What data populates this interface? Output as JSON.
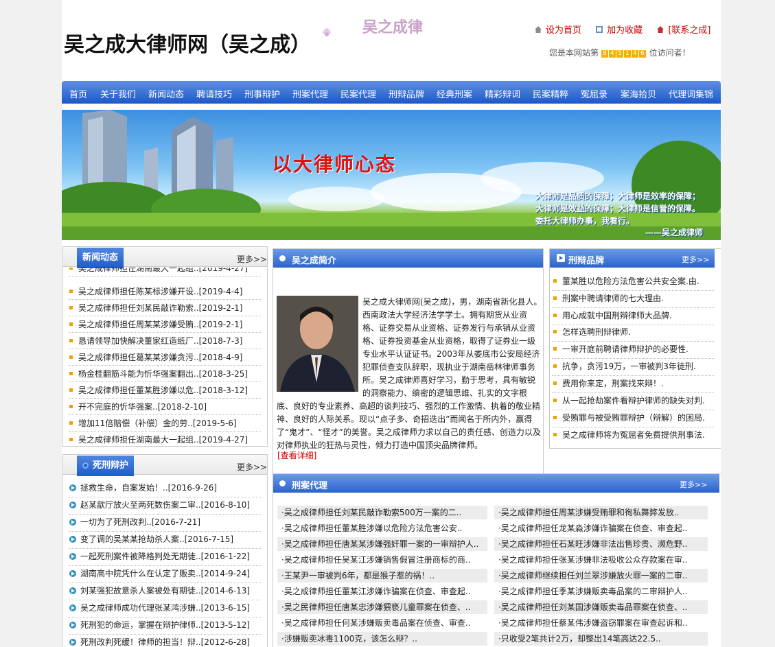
{
  "header": {
    "site_title": "吴之成大律师网（吴之成）",
    "logo_text": "吴之成律",
    "links": {
      "home": "设为首页",
      "favorite": "加为收藏",
      "contact": "[联系之成]"
    },
    "visitor_prefix": "您是本网站第",
    "visitor_digits": [
      "8",
      "4",
      "5",
      "1",
      "4",
      "6"
    ],
    "visitor_suffix": "位访问者！"
  },
  "nav": [
    "首页",
    "关于我们",
    "新闻动态",
    "聘请技巧",
    "刑事辩护",
    "刑案代理",
    "民案代理",
    "刑辩品牌",
    "经典刑案",
    "精彩辩词",
    "民案精粹",
    "冤屈录",
    "案海拾贝",
    "代理词集锦"
  ],
  "banner": {
    "slogan": "以大律师心态",
    "lines": [
      "大律师是品质的保障；大律师是效率的保障；",
      "大律师是效益的保障；大律师是信誉的保障。",
      "委托大律师办事，我看行。",
      "——吴之成律师"
    ]
  },
  "news": {
    "title": "新闻动态",
    "more": "更多>>",
    "items": [
      "吴之成律师担任湖南最大一起组..[2019-4-27]",
      "吴之成律师担任陈某标涉嫌开设..[2019-4-4]",
      "吴之成律师担任刘某民敲诈勒索..[2019-2-1]",
      "吴之成律师担任周某某涉嫌受贿..[2019-2-1]",
      "恳请领导加快解决董家红造纸厂..[2018-7-3]",
      "吴之成律师担任葛某某涉嫌贪污..[2018-4-9]",
      "杨金桂翻筋斗能为忻华强案翻出..[2018-3-25]",
      "吴之成律师担任董某胜涉嫌以危..[2018-3-12]",
      "开不完庭的忻华强案..[2018-2-10]",
      "增加11倍赔偿（补偿）金的劳..[2019-5-6]",
      "吴之成律师担任湖南最大一起组..[2019-4-27]"
    ]
  },
  "death_defense": {
    "title": "死刑辩护",
    "more": "更多>>",
    "items": [
      "拯救生命，自案发始！..[2016-9-26]",
      "赵某歆厅放火至两死数伤案二审..[2016-8-10]",
      "一切为了死刑改判..[2016-7-21]",
      "变了调的吴某某抢劫杀人案..[2016-7-15]",
      "一起死刑案件被降格判处无期徒..[2016-1-22]",
      "湖南高中院凭什么在认定了贩卖..[2014-9-24]",
      "刘某强犯故意杀人案被处有期徒..[2014-6-13]",
      "吴之成律师成功代理张某鸿涉嫌..[2013-6-15]",
      "死刑犯的命运，掌握在辩护律师..[2013-5-12]",
      "死刑改判死缓！律师的担当！辩..[2012-6-28]"
    ]
  },
  "profile": {
    "title": "吴之成简介",
    "text": "吴之成大律师网(吴之成)，男，湖南省新化县人。西南政法大学经济法学学士。拥有期货从业资格、证券交易从业资格、证券发行与承销从业资格、证券投资基金从业资格，取得了证券业一级专业水平认证证书。2003年从娄底市公安局经济犯罪侦查支队辞职，现执业于湖南岳林律师事务所。吴之成律师喜好学习，勤于思考，具有敏锐的洞察能力、缜密的逻辑思维、扎实的文字根底、良好的专业素养、高超的谈判技巧、强烈的工作激情、执着的敬业精神、良好的人际关系。现以“点子多、奇招迭出”而闻名于所内外，赢得了“鬼才”、“怪才”的美誉。吴之成律师力求以自己的责任感、创造力以及对律师执业的狂热与灵性，倾力打造中国顶尖品牌律师。",
    "detail": "[查看详细]"
  },
  "brand": {
    "title": "刑辩品牌",
    "more": "更多>>",
    "items": [
      "董某胜以危险方法危害公共安全案.由.",
      "刑案中聘请律师的七大理由.",
      "用心成就中国刑辩律师大品牌.",
      "怎样选聘刑辩律师.",
      "一审开庭前聘请律师辩护的必要性.",
      "抗争，贪污19万，一审被判3年徒刑.",
      "费用你来定，刑案找来辩！.",
      "从一起抢劫案件看辩护律师的缺失对判.",
      "受贿罪与被受贿罪辩护（辩解）的困局.",
      "吴之成律师将为冤屈者免费提供刑事法."
    ]
  },
  "criminal_agency": {
    "title": "刑案代理",
    "more": "更多>>",
    "left": [
      "·吴之成律师担任刘某民敲诈勒索500万一案的二..",
      "·吴之成律师担任董某胜涉嫌以危险方法危害公安..",
      "·吴之成律师担任唐某某涉嫌强奸罪一案的一审辩护人..",
      "·吴之成律师担任吴某江涉嫌销售假冒注册商标的商..",
      "·王某尹一审被判6年，都是猴子惹的祸！..",
      "·吴之成律师担任董某江涉嫌诈骗案在侦查、审查起..",
      "·吴之民律师担任唐某忠涉嫌猥亵儿童罪案在侦查、..",
      "·吴之成律师担任何某涉嫌贩卖毒品案在侦查、审查..",
      "·涉嫌贩卖冰毒1100克，该怎么辩？.."
    ],
    "right": [
      "·吴之成律师担任周某涉嫌受贿罪和徇私舞弊发放..",
      "·吴之成律师担任龙某淼涉嫌诈骗案在侦查、审查起..",
      "·吴之成律师担任石某旺涉嫌非法出售珍贵、濒危野..",
      "·吴之成律师担任张某涉嫌非法吸收公众存款案在审..",
      "·吴之成律师继续担任刘兰翠涉嫌放火罪一案的二审..",
      "·吴之成律师担任季某涉嫌贩卖毒品案的二审辩护人..",
      "·吴之成律师担任刘某国涉嫌贩卖毒品罪案在侦查、..",
      "·吴之成律师担任蔡某伟涉嫌盗窃罪案在审查起诉和..",
      "·只收受2笔共计2万，却整出14笔高达22.5.."
    ]
  }
}
